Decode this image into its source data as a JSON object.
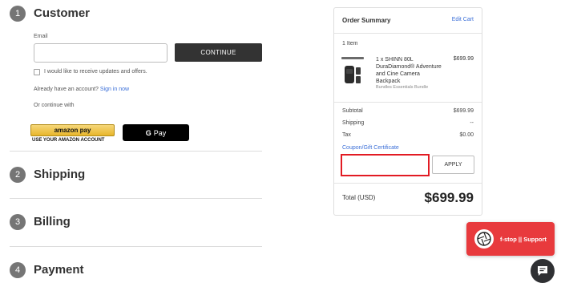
{
  "steps": [
    {
      "number": "1",
      "title": "Customer"
    },
    {
      "number": "2",
      "title": "Shipping"
    },
    {
      "number": "3",
      "title": "Billing"
    },
    {
      "number": "4",
      "title": "Payment"
    }
  ],
  "customer": {
    "email_label": "Email",
    "email_value": "",
    "continue_label": "CONTINUE",
    "newsletter_label": "I would like to receive updates and offers.",
    "account_prompt": "Already have an account?",
    "sign_in_link": "Sign in now",
    "or_continue": "Or continue with",
    "amazon_pay_label": "amazon pay",
    "amazon_caption": "USE YOUR AMAZON ACCOUNT",
    "gpay_label": "Pay",
    "gpay_g": "G"
  },
  "summary": {
    "title": "Order Summary",
    "edit_link": "Edit Cart",
    "item_count": "1 Item",
    "product": {
      "name": "1 x SHINN 80L DuraDiamond® Adventure and Cine Camera Backpack",
      "bundle": "Bundles Essentials Bundle",
      "price": "$699.99"
    },
    "rows": [
      {
        "label": "Subtotal",
        "value": "$699.99"
      },
      {
        "label": "Shipping",
        "value": "--"
      },
      {
        "label": "Tax",
        "value": "$0.00"
      }
    ],
    "coupon_link": "Coupon/Gift Certificate",
    "coupon_value": "",
    "apply_label": "APPLY",
    "total_label": "Total (USD)",
    "total_value": "$699.99"
  },
  "support": {
    "label": "f-stop || Support"
  },
  "colors": {
    "accent_red": "#e83a3d",
    "link_blue": "#3b6fd8",
    "dark_button": "#333333",
    "coupon_border": "#e21b23"
  },
  "icons": {
    "support": "aperture-logo-icon",
    "chat": "chat-bubble-icon",
    "product": "backpack-thumbnail-icon"
  }
}
